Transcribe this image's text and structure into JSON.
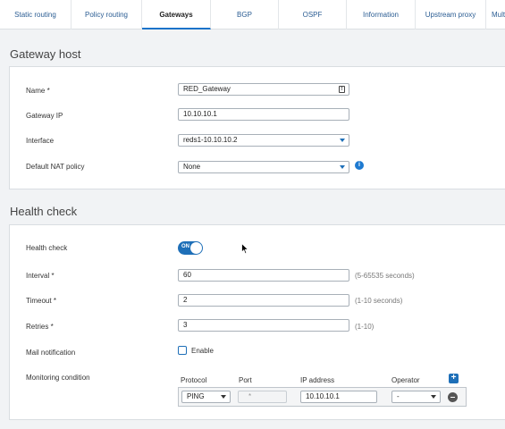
{
  "tabs": [
    {
      "label": "Static routing"
    },
    {
      "label": "Policy routing"
    },
    {
      "label": "Gateways"
    },
    {
      "label": "BGP"
    },
    {
      "label": "OSPF"
    },
    {
      "label": "Information"
    },
    {
      "label": "Upstream proxy"
    },
    {
      "label": "Multi"
    }
  ],
  "gateway_host": {
    "title": "Gateway host",
    "name_label": "Name *",
    "name_value": "RED_Gateway",
    "ip_label": "Gateway IP",
    "ip_value": "10.10.10.1",
    "interface_label": "Interface",
    "interface_value": "reds1-10.10.10.2",
    "nat_label": "Default NAT policy",
    "nat_value": "None"
  },
  "health_check": {
    "title": "Health check",
    "toggle_label": "Health check",
    "toggle_text": "ON",
    "interval_label": "Interval *",
    "interval_value": "60",
    "interval_hint": "(5-65535 seconds)",
    "timeout_label": "Timeout *",
    "timeout_value": "2",
    "timeout_hint": "(1-10 seconds)",
    "retries_label": "Retries *",
    "retries_value": "3",
    "retries_hint": "(1-10)",
    "mail_label": "Mail notification",
    "mail_checkbox_label": "Enable",
    "monitoring_label": "Monitoring condition",
    "columns": {
      "protocol": "Protocol",
      "port": "Port",
      "ip": "IP address",
      "operator": "Operator"
    },
    "row": {
      "protocol": "PING",
      "port": "*",
      "ip": "10.10.10.1",
      "operator": "-"
    }
  }
}
